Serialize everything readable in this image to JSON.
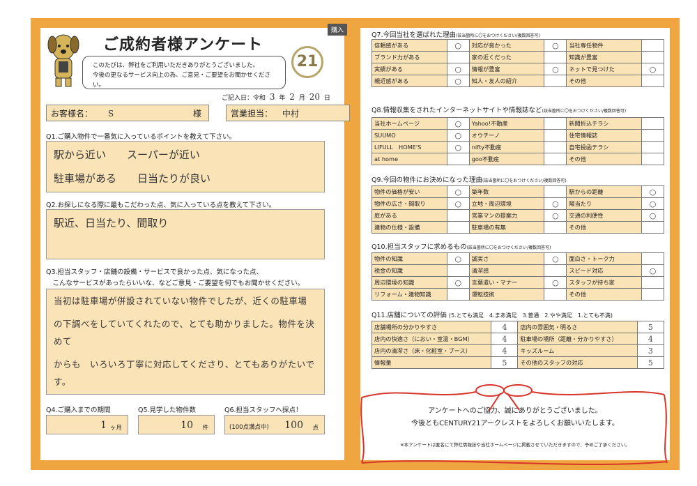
{
  "header": {
    "buy_tag": "購入",
    "title": "ご成約者様アンケート",
    "intro_line1": "このたびは、弊社をご利用いただきありがとうございました。",
    "intro_line2": "今後の更なるサービス向上の為、ご意見・ご要望をお聞かせください。",
    "logo": "21",
    "date_label": "ご記入日：令和",
    "date_year": "3",
    "date_year_unit": "年",
    "date_month": "2",
    "date_month_unit": "月",
    "date_day": "20",
    "date_day_unit": "日"
  },
  "customer": {
    "name_label": "お客様名：",
    "name_value": "S",
    "name_suffix": "様",
    "staff_label": "営業担当：",
    "staff_value": "中村"
  },
  "q1": {
    "label": "Q1.ご購入物件で一番気に入っているポイントを教えて下さい。",
    "answer_line1": "駅から近い　　スーパーが近い",
    "answer_line2": "駐車場がある　　日当たりが良い"
  },
  "q2": {
    "label": "Q2.お探しになる際に最もこだわった点、気に入っている点を教えて下さい。",
    "answer": "駅近、日当たり、間取り"
  },
  "q3": {
    "label_line1": "Q3.担当スタッフ・店舗の設備・サービスで良かった点、気になった点、",
    "label_line2": "　こんなサービスがあったらいいな、などご意見・ご要望を何でもお聞かせください。",
    "answer_line1": "当初は駐車場が併設されていない物件でしたが、近くの駐車場",
    "answer_line2": "の下調べをしていてくれたので、とても助かりました。物件を決めて",
    "answer_line3": "からも　いろいろ丁寧に対応してくださり、とてもありがたいです。"
  },
  "q4": {
    "label": "Q4.ご購入までの期間",
    "value": "1",
    "unit": "ヶ月"
  },
  "q5": {
    "label": "Q5.見学した物件数",
    "value": "10",
    "unit": "件"
  },
  "q6": {
    "label": "Q6.担当スタッフへ採点！",
    "prefix": "(100点満点中)",
    "value": "100",
    "unit": "点"
  },
  "q7": {
    "title": "Q7.今回当社を選ばれた理由",
    "note": "(該当箇所に〇をおつけください/複数回答可)",
    "rows": [
      [
        {
          "label": "信頼感がある",
          "mark": "○"
        },
        {
          "label": "対応が良かった",
          "mark": "○"
        },
        {
          "label": "当社専任物件",
          "mark": ""
        }
      ],
      [
        {
          "label": "ブランド力がある",
          "mark": ""
        },
        {
          "label": "家の近くだった",
          "mark": ""
        },
        {
          "label": "知識が豊富",
          "mark": ""
        }
      ],
      [
        {
          "label": "実績がある",
          "mark": "○"
        },
        {
          "label": "情報が豊富",
          "mark": "○"
        },
        {
          "label": "ネットで見つけた",
          "mark": "○"
        }
      ],
      [
        {
          "label": "親近感がある",
          "mark": "○"
        },
        {
          "label": "知人・友人の紹介",
          "mark": ""
        },
        {
          "label": "その他",
          "mark": ""
        }
      ]
    ]
  },
  "q8": {
    "title": "Q8.情報収集をされたインターネットサイトや情報誌など",
    "note": "(該当箇所に〇をおつけください/複数回答可)",
    "rows": [
      [
        {
          "label": "当社ホームページ",
          "mark": "○"
        },
        {
          "label": "Yahoo!不動産",
          "mark": ""
        },
        {
          "label": "新聞折込チラシ",
          "mark": ""
        }
      ],
      [
        {
          "label": "SUUMO",
          "mark": "○"
        },
        {
          "label": "オウチーノ",
          "mark": ""
        },
        {
          "label": "住宅情報誌",
          "mark": ""
        }
      ],
      [
        {
          "label": "LIFULL　HOME'S",
          "mark": "○"
        },
        {
          "label": "nifty不動産",
          "mark": ""
        },
        {
          "label": "自宅投函チラシ",
          "mark": ""
        }
      ],
      [
        {
          "label": "at home",
          "mark": ""
        },
        {
          "label": "goo不動産",
          "mark": ""
        },
        {
          "label": "その他",
          "mark": ""
        }
      ]
    ]
  },
  "q9": {
    "title": "Q9.今回の物件にお決めになった理由",
    "note": "(該当箇所に〇をおつけください/複数回答可)",
    "rows": [
      [
        {
          "label": "物件の価格が安い",
          "mark": "○"
        },
        {
          "label": "築年数",
          "mark": ""
        },
        {
          "label": "駅からの距離",
          "mark": "○"
        }
      ],
      [
        {
          "label": "物件の広さ・間取り",
          "mark": "○"
        },
        {
          "label": "立地・周辺環境",
          "mark": "○"
        },
        {
          "label": "陽当たり",
          "mark": "○"
        }
      ],
      [
        {
          "label": "庭がある",
          "mark": ""
        },
        {
          "label": "営業マンの提案力",
          "mark": "○"
        },
        {
          "label": "交通の利便性",
          "mark": "○"
        }
      ],
      [
        {
          "label": "建物の仕様・設備",
          "mark": ""
        },
        {
          "label": "駐車場の有無",
          "mark": ""
        },
        {
          "label": "その他",
          "mark": ""
        }
      ]
    ]
  },
  "q10": {
    "title": "Q10.担当スタッフに求めるもの",
    "note": "(該当箇所に〇をおつけください/複数回答可)",
    "rows": [
      [
        {
          "label": "物件の知識",
          "mark": "○"
        },
        {
          "label": "誠実さ",
          "mark": "○"
        },
        {
          "label": "面白さ・トーク力",
          "mark": ""
        }
      ],
      [
        {
          "label": "税金の知識",
          "mark": ""
        },
        {
          "label": "清潔感",
          "mark": ""
        },
        {
          "label": "スピード対応",
          "mark": "○"
        }
      ],
      [
        {
          "label": "周辺環境の知識",
          "mark": "○"
        },
        {
          "label": "言葉遣い・マナー",
          "mark": "○"
        },
        {
          "label": "スタッフが持ち家",
          "mark": ""
        }
      ],
      [
        {
          "label": "リフォーム・建物知識",
          "mark": ""
        },
        {
          "label": "運転技術",
          "mark": ""
        },
        {
          "label": "その他",
          "mark": ""
        }
      ]
    ]
  },
  "q11": {
    "title": "Q11.店舗についての評価",
    "scale": "(5.とても満足　4.まあ満足　3.普通　2.やや満足　1.とても不満)",
    "rows": [
      [
        {
          "label": "店舗場所の分かりやすさ",
          "mark": "4"
        },
        {
          "label": "店内の雰囲気・明るさ",
          "mark": "5"
        }
      ],
      [
        {
          "label": "店内の快適さ（におい・室温・BGM）",
          "mark": "4"
        },
        {
          "label": "駐車場の場所（距離・分かりやすさ）",
          "mark": "4"
        }
      ],
      [
        {
          "label": "店内の清潔さ（床・化粧室・ブース）",
          "mark": "4"
        },
        {
          "label": "キッズルーム",
          "mark": "3"
        }
      ],
      [
        {
          "label": "情報量",
          "mark": "5"
        },
        {
          "label": "その他のスタッフの対応",
          "mark": "5"
        }
      ]
    ]
  },
  "footer": {
    "thanks_line1": "アンケートへのご協力、誠にありがとうございました。",
    "thanks_line2": "今後ともCENTURY21アークレストをよろしくお願いいたします。",
    "note": "※本アンケートは匿名にて弊社情報誌や当社ホームページに掲載させていただきますので、予めご了承ください。"
  },
  "colors": {
    "frame": "#f0a640",
    "cell": "#fbe3b8",
    "ribbon": "#d8342a"
  }
}
